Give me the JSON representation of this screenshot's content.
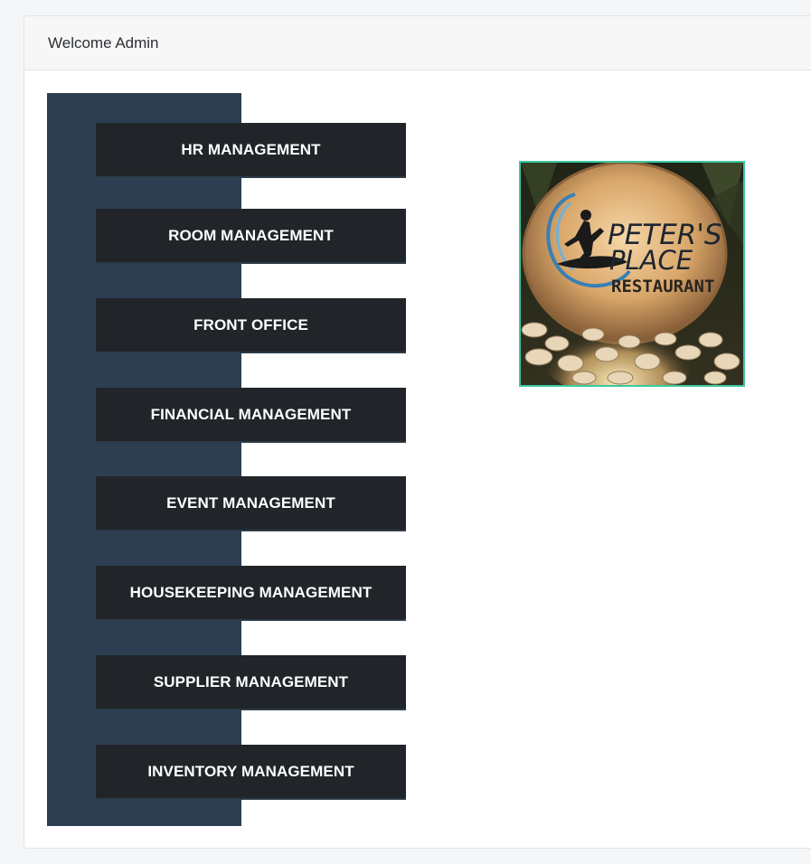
{
  "header": {
    "welcome_text": "Welcome Admin"
  },
  "menu": {
    "items": [
      {
        "label": "HR MANAGEMENT"
      },
      {
        "label": "ROOM MANAGEMENT"
      },
      {
        "label": "FRONT OFFICE"
      },
      {
        "label": "FINANCIAL MANAGEMENT"
      },
      {
        "label": "EVENT MANAGEMENT"
      },
      {
        "label": "HOUSEKEEPING MANAGEMENT"
      },
      {
        "label": "SUPPLIER MANAGEMENT"
      },
      {
        "label": "INVENTORY MANAGEMENT"
      }
    ]
  },
  "logo": {
    "line1": "PETER'S",
    "line2": "PLACE",
    "line3": "RESTAURANT"
  },
  "colors": {
    "sidebar": "#2c3e50",
    "button": "#212529",
    "logo_border": "#3cc8a0"
  }
}
